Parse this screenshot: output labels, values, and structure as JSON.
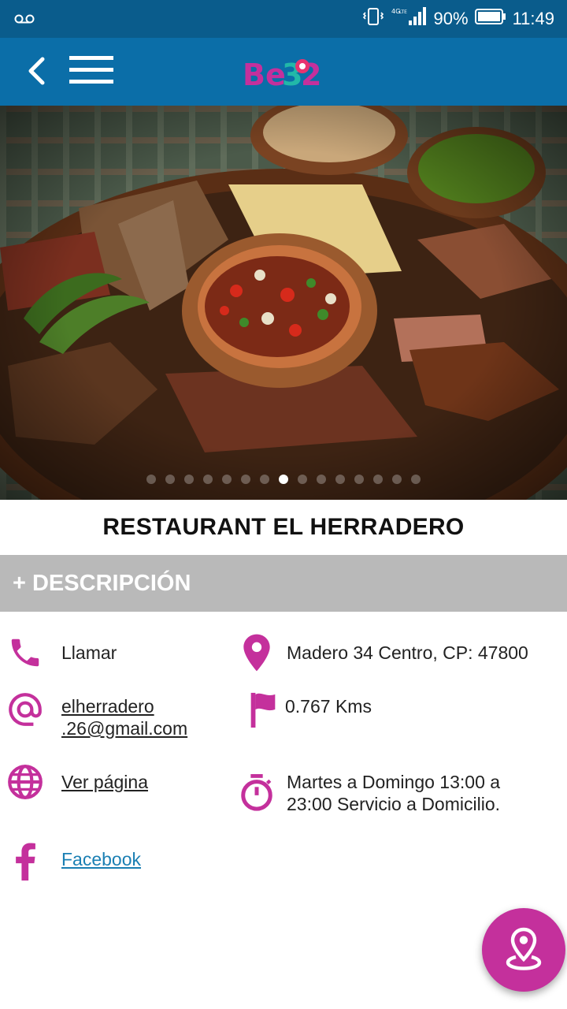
{
  "status_bar": {
    "network": "4G LTE",
    "battery": "90%",
    "time": "11:49"
  },
  "app_bar": {
    "logo_text": "Be32"
  },
  "hero": {
    "slide_count": 15,
    "active_slide": 8
  },
  "restaurant": {
    "name": "RESTAURANT EL HERRADERO"
  },
  "description": {
    "label": "+ DESCRIPCIÓN"
  },
  "contact": {
    "call_label": "Llamar",
    "email_line1": "elherradero",
    "email_line2": ".26@gmail.com",
    "web_label": "Ver página",
    "facebook_label": "Facebook",
    "address": "Madero 34  Centro, CP: 47800",
    "distance": "0.767 Kms",
    "hours_line1": "Martes a Domingo 13:00 a",
    "hours_line2": "23:00 Servicio a Domicilio."
  },
  "colors": {
    "status_bar": "#0a5c8c",
    "app_bar": "#0b6ea8",
    "accent": "#c4309c",
    "description_bar": "#b9b9b9"
  },
  "icons": {
    "phone": "phone-icon",
    "email": "at-icon",
    "web": "globe-icon",
    "facebook": "facebook-icon",
    "location": "map-pin-icon",
    "distance": "flag-icon",
    "hours": "timer-icon",
    "fab": "map-location-icon"
  }
}
